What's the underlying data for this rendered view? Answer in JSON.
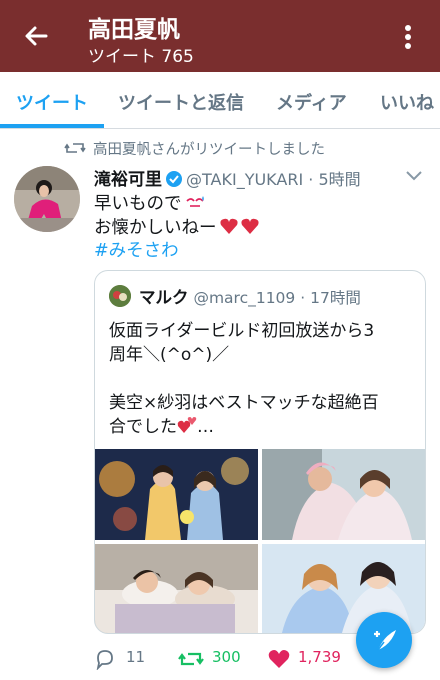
{
  "header": {
    "title": "高田夏帆",
    "subtitle": "ツイート 765",
    "back_icon": "arrow-left-icon",
    "menu_icon": "kebab-menu-icon",
    "bg_color": "#7a2e2e"
  },
  "tabs": [
    {
      "label": "ツイート",
      "active": true
    },
    {
      "label": "ツイートと返信",
      "active": false
    },
    {
      "label": "メディア",
      "active": false
    },
    {
      "label": "いいね",
      "active": false
    }
  ],
  "tweet": {
    "retweet_notice": "高田夏帆さんがリツイートしました",
    "author_name": "滝裕可里",
    "verified": true,
    "handle": "@TAKI_YUKARI",
    "separator": "·",
    "time": "5時間",
    "text_line1": "早いもので",
    "text_line2": "お懐かしいねー",
    "hashtag": "#みそさわ",
    "emoji_line1": "sweat-smile",
    "emoji_line2": "red-hearts",
    "quote": {
      "author_name": "マルク",
      "handle": "@marc_1109",
      "separator": "·",
      "time": "17時間",
      "line1": "仮面ライダービルド初回放送から3",
      "line2": "周年＼(^o^)／",
      "line3": "美空×紗羽はベストマッチな超絶百",
      "line4": "合でした",
      "line4_suffix": "…",
      "media_count": 4
    },
    "actions": {
      "replies": "11",
      "retweets": "300",
      "likes": "1,739",
      "retweet_color": "#17bf63",
      "like_color": "#e0245e"
    }
  },
  "accent_color": "#1da1f2"
}
